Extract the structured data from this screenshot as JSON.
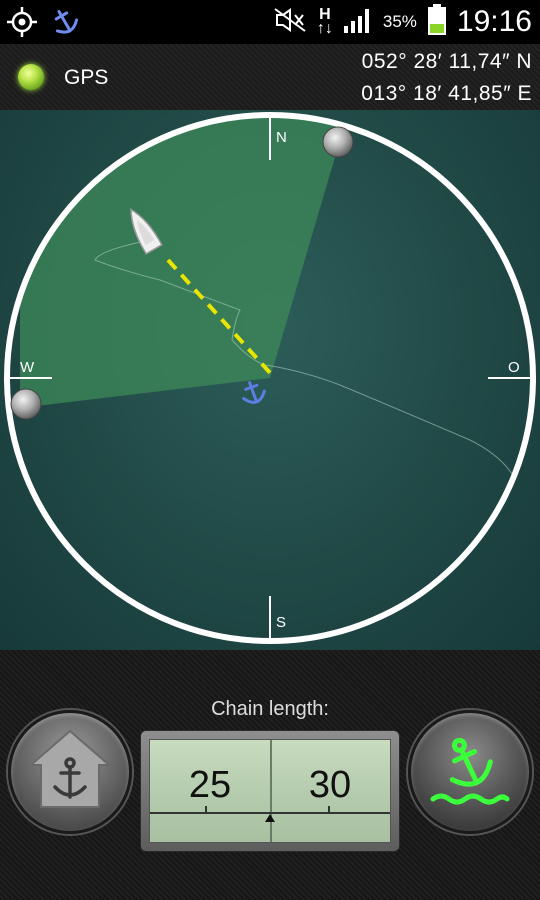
{
  "status_bar": {
    "battery": "35%",
    "clock": "19:16",
    "network": "H"
  },
  "gps": {
    "label": "GPS",
    "latitude": "052° 28′ 11,74″ N",
    "longitude": "013° 18′ 41,85″ E",
    "led_color": "#b9e44a"
  },
  "compass": {
    "north": "N",
    "south": "S",
    "west": "W",
    "east": "O"
  },
  "chain": {
    "label": "Chain length:",
    "value_left": "25",
    "value_right": "30"
  },
  "colors": {
    "water": "#1f4744",
    "sector": "#3e8a5a",
    "anchor_accent": "#5b7fe0",
    "drop_anchor": "#3cff3c",
    "track_line": "#e8e600"
  },
  "icons": {
    "gps_status": "crosshair-icon",
    "anchor_status": "anchor-icon",
    "no_signal": "muted-icon",
    "signal": "signal-bars-icon",
    "battery": "battery-icon",
    "home_anchor": "home-anchor-icon",
    "drop_anchor": "drop-anchor-icon",
    "boat": "boat-icon"
  }
}
